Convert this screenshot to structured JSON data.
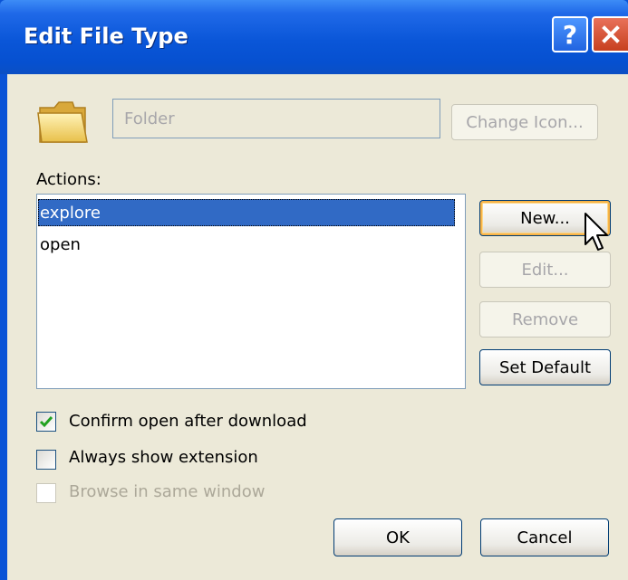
{
  "window": {
    "title": "Edit File Type",
    "help_glyph": "?",
    "close_glyph": "×"
  },
  "type_name": {
    "value": "Folder",
    "icon": "folder-icon"
  },
  "buttons": {
    "change_icon": "Change Icon...",
    "new": "New...",
    "edit": "Edit...",
    "remove": "Remove",
    "set_default": "Set Default",
    "ok": "OK",
    "cancel": "Cancel"
  },
  "actions": {
    "label": "Actions:",
    "items": [
      {
        "label": "explore",
        "selected": true
      },
      {
        "label": "open",
        "selected": false
      }
    ]
  },
  "options": {
    "confirm_open": {
      "label": "Confirm open after download",
      "checked": true,
      "enabled": true
    },
    "always_show_ext": {
      "label": "Always show extension",
      "checked": false,
      "enabled": true
    },
    "browse_same_window": {
      "label": "Browse in same window",
      "checked": false,
      "enabled": false
    }
  },
  "colors": {
    "title_bar": "#0a56d8",
    "dialog_bg": "#ece9d8",
    "selection": "#316ac5",
    "check_mark": "#21a121"
  }
}
